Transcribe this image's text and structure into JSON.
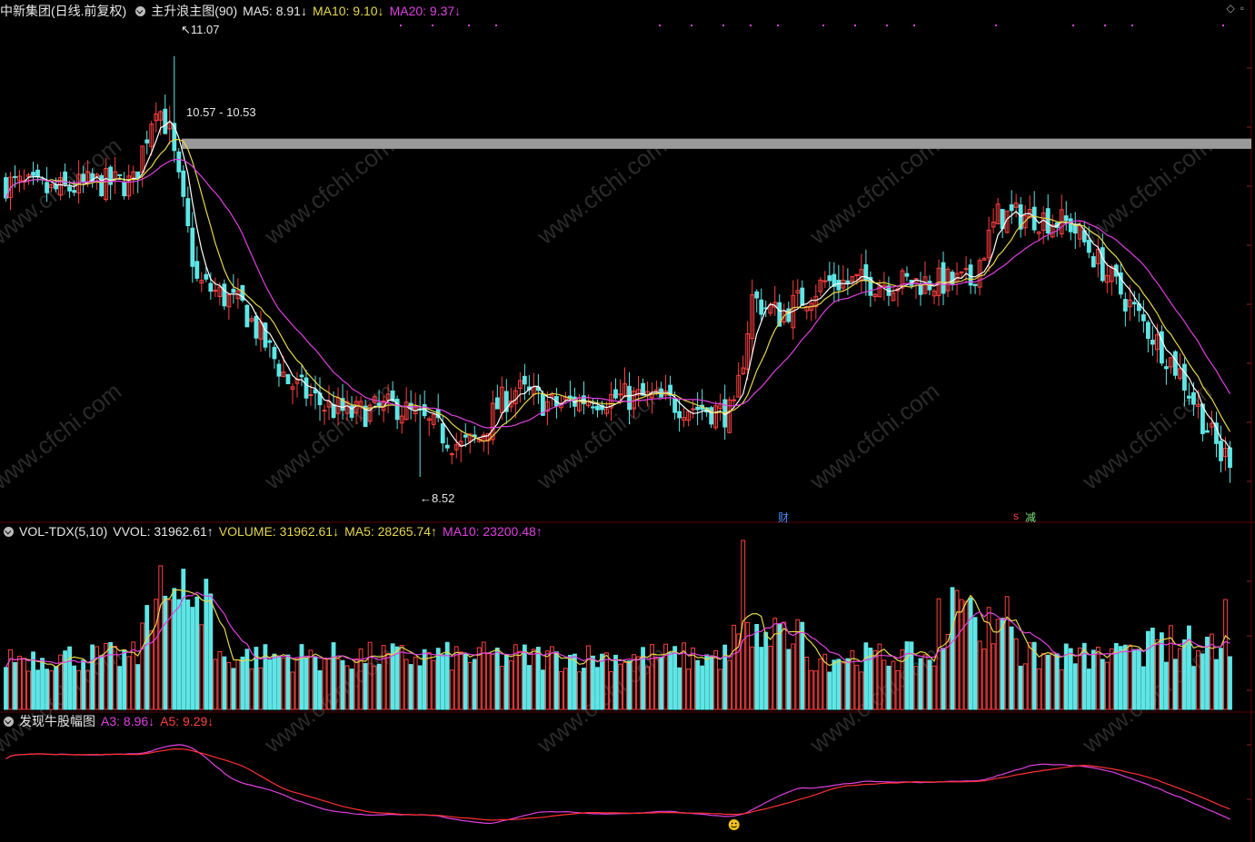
{
  "header_main": {
    "stock": "中新集团(日线.前复权)",
    "indicator": "主升浪主图(90)",
    "ma5": "MA5: 8.91↓",
    "ma10": "MA10: 9.10↓",
    "ma20": "MA20: 9.37↓"
  },
  "header_vol": {
    "name": "VOL-TDX(5,10)",
    "vvol": "VVOL: 31962.61↑",
    "volume": "VOLUME: 31962.61↓",
    "ma5": "MA5: 28265.74↑",
    "ma10": "MA10: 23200.48↑"
  },
  "header_ind": {
    "name": "发现牛股幅图",
    "a3": "A3: 8.96↓",
    "a5": "A5: 9.29↓"
  },
  "annotations": {
    "high": "11.07",
    "low": "8.52",
    "band": "10.57 - 10.53",
    "event_fin": "财",
    "event_cut": "减",
    "event_s": "s"
  },
  "watermark": "www.cfchi.com",
  "colors": {
    "up": "#ff4040",
    "down": "#5ee6e6",
    "ma5": "#ffffff",
    "ma10": "#e6d84a",
    "ma20": "#e040e0",
    "a3": "#e040e0",
    "a5": "#ff3030",
    "band": "#9a9a9a"
  },
  "chart_data": [
    {
      "type": "candlestick",
      "title": "中新集团(日线.前复权)",
      "ylim": [
        8.3,
        11.3
      ],
      "annotations": {
        "high": 11.07,
        "low": 8.52,
        "band": [
          10.53,
          10.57
        ]
      },
      "waypoints": [
        [
          0,
          10.3
        ],
        [
          10,
          10.25
        ],
        [
          20,
          10.3
        ],
        [
          28,
          10.3
        ],
        [
          33,
          10.8
        ],
        [
          36,
          10.6
        ],
        [
          42,
          9.7
        ],
        [
          52,
          9.55
        ],
        [
          62,
          9.1
        ],
        [
          70,
          8.95
        ],
        [
          76,
          8.9
        ],
        [
          86,
          8.95
        ],
        [
          95,
          8.8
        ],
        [
          100,
          8.7
        ],
        [
          104,
          8.75
        ],
        [
          108,
          8.95
        ],
        [
          112,
          9.05
        ],
        [
          120,
          8.95
        ],
        [
          128,
          9.0
        ],
        [
          140,
          9.0
        ],
        [
          150,
          8.95
        ],
        [
          160,
          8.9
        ],
        [
          164,
          9.6
        ],
        [
          170,
          9.5
        ],
        [
          180,
          9.7
        ],
        [
          200,
          9.7
        ],
        [
          212,
          9.7
        ],
        [
          218,
          10.1
        ],
        [
          226,
          10.1
        ],
        [
          234,
          10.05
        ],
        [
          246,
          9.6
        ],
        [
          258,
          9.15
        ],
        [
          267,
          8.65
        ],
        [
          270,
          8.65
        ]
      ]
    },
    {
      "type": "bar",
      "title": "VOL-TDX(5,10)",
      "values_summary": {
        "vvol": 31962.61,
        "volume": 31962.61,
        "ma5": 28265.74,
        "ma10": 23200.48
      }
    },
    {
      "type": "line",
      "title": "发现牛股幅图",
      "series": [
        {
          "name": "A3",
          "last": 8.96
        },
        {
          "name": "A5",
          "last": 9.29
        }
      ]
    }
  ]
}
